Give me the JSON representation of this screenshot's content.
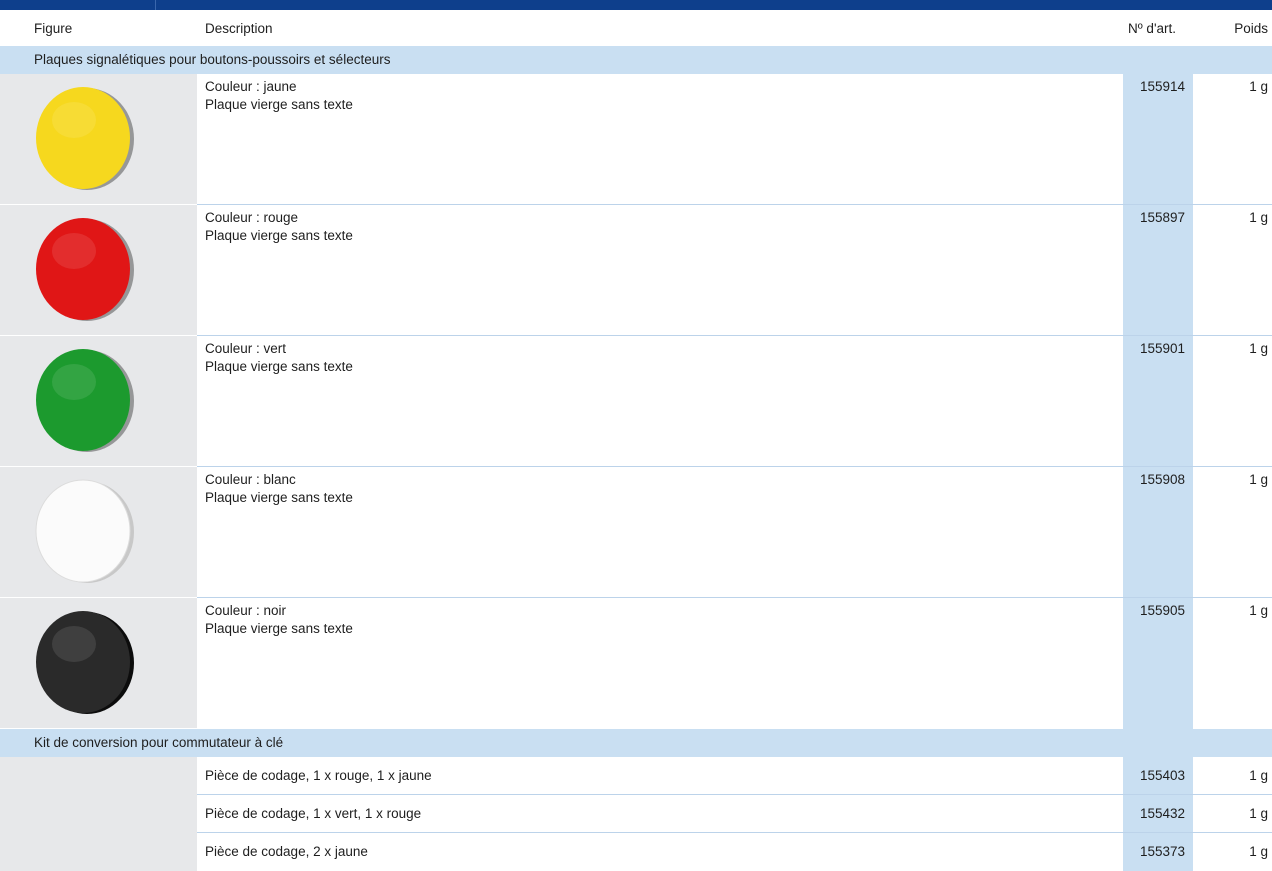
{
  "header": {
    "col_figure": "Figure",
    "col_description": "Description",
    "col_article": "Nº d'art.",
    "col_weight": "Poids"
  },
  "colors": {
    "header_bar": "#0e3f8c",
    "section_band": "#c9dff2",
    "figure_column": "#e7e8ea"
  },
  "section1": {
    "title": "Plaques signalétiques pour boutons-poussoirs et sélecteurs",
    "items": [
      {
        "color_name": "yellow",
        "disc_color": "#f6d81e",
        "line1": "Couleur : jaune",
        "line2": "Plaque vierge sans texte",
        "article": "155914",
        "weight": "1 g"
      },
      {
        "color_name": "red",
        "disc_color": "#e01616",
        "line1": "Couleur : rouge",
        "line2": "Plaque vierge sans texte",
        "article": "155897",
        "weight": "1 g"
      },
      {
        "color_name": "green",
        "disc_color": "#1c9a2e",
        "line1": "Couleur : vert",
        "line2": "Plaque vierge sans texte",
        "article": "155901",
        "weight": "1 g"
      },
      {
        "color_name": "white",
        "disc_color": "#fbfbfb",
        "line1": "Couleur : blanc",
        "line2": "Plaque vierge sans texte",
        "article": "155908",
        "weight": "1 g"
      },
      {
        "color_name": "black",
        "disc_color": "#2a2a2a",
        "line1": "Couleur : noir",
        "line2": "Plaque vierge sans texte",
        "article": "155905",
        "weight": "1 g"
      }
    ]
  },
  "section2": {
    "title": "Kit de conversion pour commutateur à clé",
    "items": [
      {
        "description": "Pièce de codage, 1 x rouge, 1 x jaune",
        "article": "155403",
        "weight": "1 g"
      },
      {
        "description": "Pièce de codage, 1 x vert, 1 x rouge",
        "article": "155432",
        "weight": "1 g"
      },
      {
        "description": "Pièce de codage, 2 x jaune",
        "article": "155373",
        "weight": "1 g"
      }
    ]
  }
}
